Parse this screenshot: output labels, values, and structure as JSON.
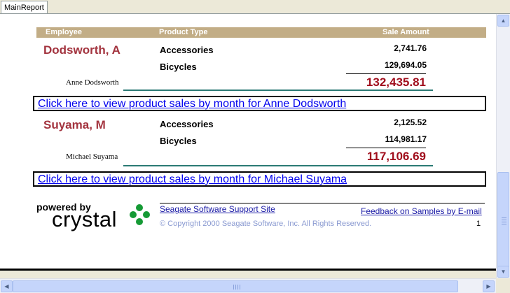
{
  "tabs": [
    {
      "label": "MainReport"
    }
  ],
  "header": {
    "employee": "Employee",
    "product_type": "Product Type",
    "sale_amount": "Sale Amount"
  },
  "groups": [
    {
      "employee": "Dodsworth, A",
      "rows": [
        {
          "product": "Accessories",
          "amount": "2,741.76"
        },
        {
          "product": "Bicycles",
          "amount": "129,694.05"
        }
      ],
      "signature": "Anne Dodsworth",
      "total": "132,435.81",
      "link": "Click here to view product sales by month for Anne Dodsworth"
    },
    {
      "employee": "Suyama, M",
      "rows": [
        {
          "product": "Accessories",
          "amount": "2,125.52"
        },
        {
          "product": "Bicycles",
          "amount": "114,981.17"
        }
      ],
      "signature": "Michael Suyama",
      "total": "117,106.69",
      "link": "Click here to view product sales by month for Michael Suyama"
    }
  ],
  "footer": {
    "powered_by": "powered by",
    "brand": "crystal",
    "support_link": "Seagate Software Support Site",
    "feedback_link": "Feedback on Samples by E-mail",
    "copyright": "© Copyright 2000 Seagate Software, Inc.  All Rights Reserved.",
    "page_number": "1"
  },
  "colors": {
    "header_band": "#c2ad86",
    "employee_name": "#a3343f",
    "total": "#a00d1c",
    "link": "#0000ee",
    "logo_dots": "#159a35"
  }
}
